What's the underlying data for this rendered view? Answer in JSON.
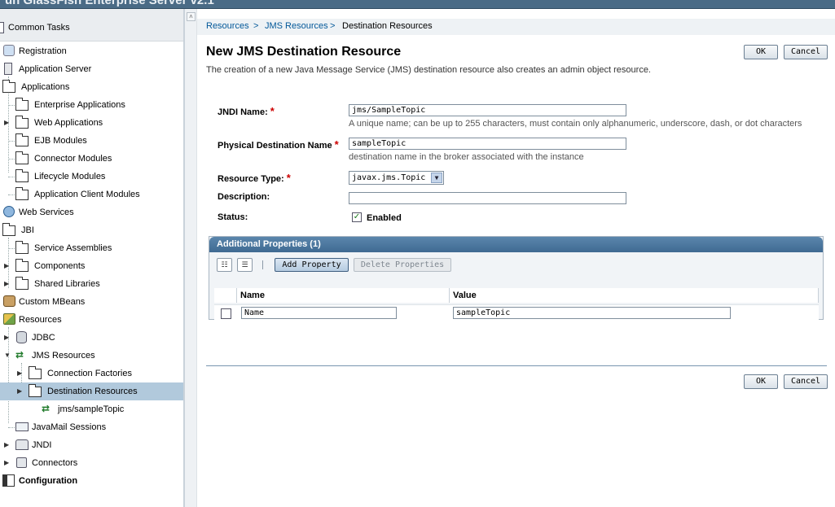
{
  "app": {
    "title": "un GlassFish  Enterprise Server v2.1"
  },
  "tree": {
    "header": "Common Tasks",
    "items": [
      {
        "label": "Registration"
      },
      {
        "label": "Application Server"
      },
      {
        "label": "Applications"
      },
      {
        "label": "Enterprise Applications"
      },
      {
        "label": "Web Applications"
      },
      {
        "label": "EJB Modules"
      },
      {
        "label": "Connector Modules"
      },
      {
        "label": "Lifecycle Modules"
      },
      {
        "label": "Application Client Modules"
      },
      {
        "label": "Web Services"
      },
      {
        "label": "JBI"
      },
      {
        "label": "Service Assemblies"
      },
      {
        "label": "Components"
      },
      {
        "label": "Shared Libraries"
      },
      {
        "label": "Custom MBeans"
      },
      {
        "label": "Resources"
      },
      {
        "label": "JDBC"
      },
      {
        "label": "JMS Resources"
      },
      {
        "label": "Connection Factories"
      },
      {
        "label": "Destination Resources"
      },
      {
        "label": "jms/sampleTopic"
      },
      {
        "label": "JavaMail Sessions"
      },
      {
        "label": "JNDI"
      },
      {
        "label": "Connectors"
      },
      {
        "label": "Configuration"
      }
    ]
  },
  "breadcrumb": {
    "items": [
      "Resources",
      "JMS Resources",
      "Destination Resources"
    ],
    "separator": ">"
  },
  "page": {
    "title": "New JMS Destination Resource",
    "description": "The creation of a new Java Message Service (JMS) destination resource also creates an admin object resource."
  },
  "buttons": {
    "ok": "OK",
    "cancel": "Cancel"
  },
  "form": {
    "jndi": {
      "label": "JNDI Name:",
      "value": "jms/SampleTopic",
      "help": "A unique name; can be up to 255 characters, must contain only alphanumeric, underscore, dash, or dot characters"
    },
    "physical": {
      "label": "Physical Destination Name",
      "value": "sampleTopic",
      "help": "destination name in the broker associated with the instance"
    },
    "type": {
      "label": "Resource Type:",
      "value": "javax.jms.Topic"
    },
    "description": {
      "label": "Description:",
      "value": ""
    },
    "status": {
      "label": "Status:",
      "checkbox_label": "Enabled",
      "checked": true
    },
    "required_mark": "*"
  },
  "properties": {
    "title": "Additional Properties (1)",
    "add_label": "Add Property",
    "delete_label": "Delete Properties",
    "columns": [
      "Name",
      "Value"
    ],
    "rows": [
      {
        "name": "Name",
        "value": "sampleTopic"
      }
    ]
  },
  "colors": {
    "accent": "#3f6a92",
    "link": "#035899",
    "required": "#cc0000",
    "selected_row": "#b1c9dc"
  }
}
